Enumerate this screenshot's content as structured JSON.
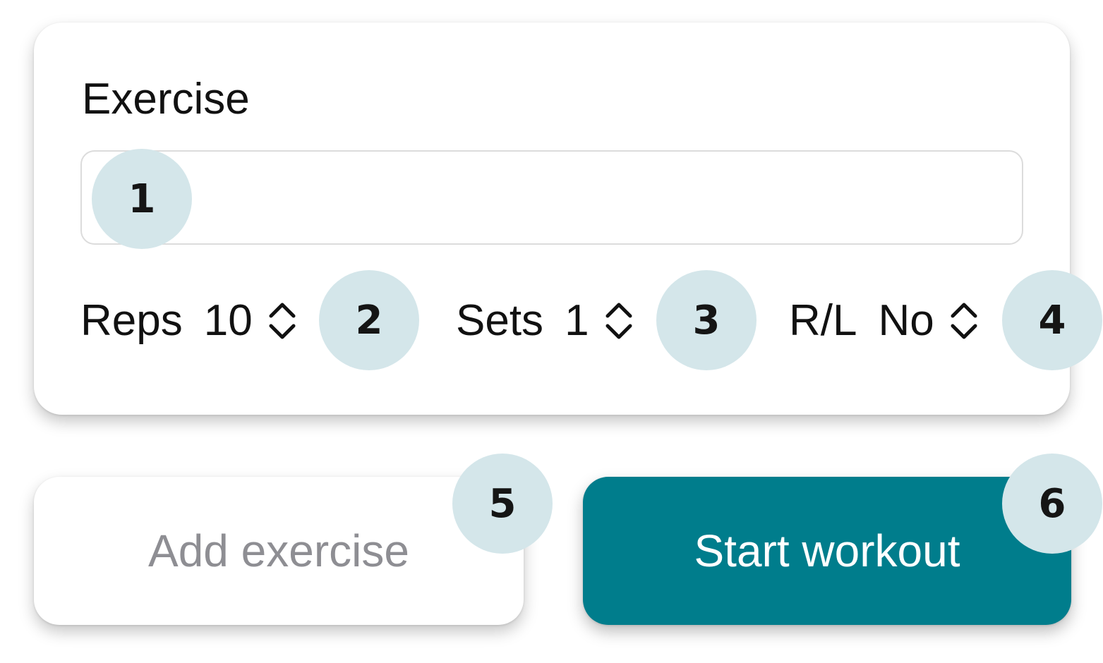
{
  "form": {
    "exercise_label": "Exercise",
    "exercise_value": "",
    "exercise_placeholder": ""
  },
  "steppers": {
    "reps": {
      "label": "Reps",
      "value": "10",
      "icon": "chevron-up-down-icon"
    },
    "sets": {
      "label": "Sets",
      "value": "1",
      "icon": "chevron-up-down-icon"
    },
    "rl": {
      "label": "R/L",
      "value": "No",
      "icon": "chevron-up-down-icon"
    }
  },
  "actions": {
    "add_exercise": "Add exercise",
    "start_workout": "Start workout"
  },
  "markers": [
    "1",
    "2",
    "3",
    "4",
    "5",
    "6"
  ],
  "colors": {
    "accent": "#007d8c",
    "marker_bg": "#d4e6ea",
    "disabled_text": "#8e8e93"
  }
}
